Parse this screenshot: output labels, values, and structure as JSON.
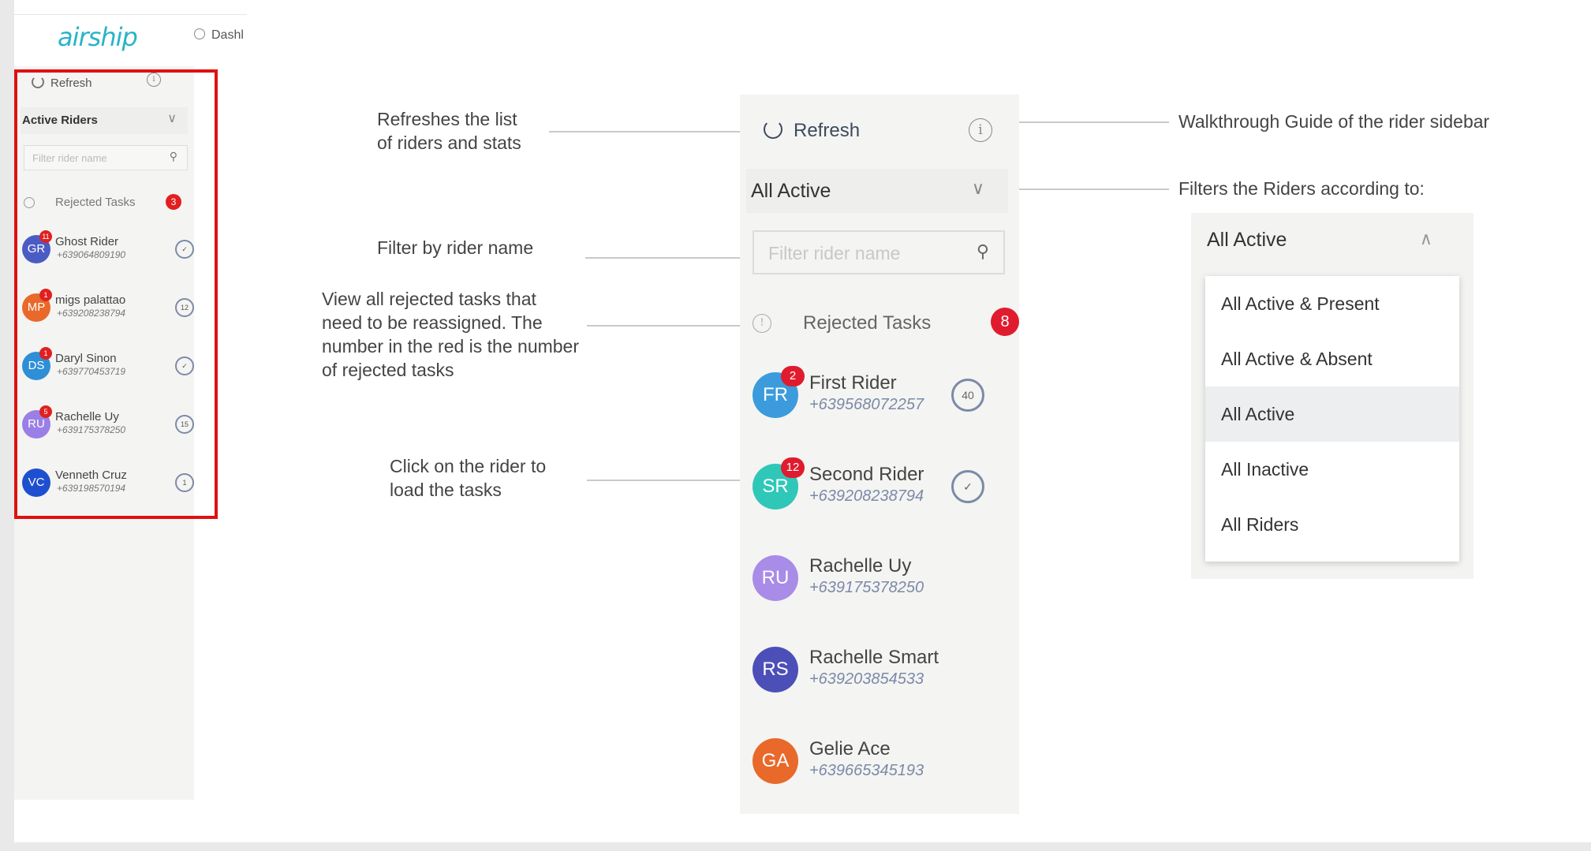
{
  "mini_app": {
    "logo": "airship",
    "dash_label": "Dashl",
    "refresh_label": "Refresh",
    "info_glyph": "i",
    "select_value": "Active Riders",
    "filter_placeholder": "Filter rider name",
    "rejected_label": "Rejected Tasks",
    "rejected_count": "3",
    "riders": [
      {
        "initials": "GR",
        "name": "Ghost Rider",
        "phone": "+639064809190",
        "badge": "11",
        "stat": "✓",
        "color": "#4a5cc4"
      },
      {
        "initials": "MP",
        "name": "migs palattao",
        "phone": "+639208238794",
        "badge": "1",
        "stat": "12",
        "color": "#e8692a"
      },
      {
        "initials": "DS",
        "name": "Daryl Sinon",
        "phone": "+639770453719",
        "badge": "1",
        "stat": "✓",
        "color": "#2e8fd6"
      },
      {
        "initials": "RU",
        "name": "Rachelle Uy",
        "phone": "+639175378250",
        "badge": "5",
        "stat": "15",
        "color": "#9a7fe6"
      },
      {
        "initials": "VC",
        "name": "Venneth Cruz",
        "phone": "+639198570194",
        "badge": "",
        "stat": "1",
        "color": "#1d4fd0"
      }
    ]
  },
  "big_sidebar": {
    "refresh_label": "Refresh",
    "info_glyph": "i",
    "select_value": "All Active",
    "select_chevron": "∨",
    "filter_placeholder": "Filter rider name",
    "search_glyph": "⚲",
    "rejected_label": "Rejected Tasks",
    "rejected_icon": "!",
    "rejected_count": "8",
    "riders": [
      {
        "initials": "FR",
        "name": "First Rider",
        "phone": "+639568072257",
        "badge": "2",
        "stat": "40",
        "color": "#3b9bdc"
      },
      {
        "initials": "SR",
        "name": "Second Rider",
        "phone": "+639208238794",
        "badge": "12",
        "stat": "✓",
        "color": "#2fc7b8"
      },
      {
        "initials": "RU",
        "name": "Rachelle Uy",
        "phone": "+639175378250",
        "badge": "",
        "stat": "",
        "color": "#a98be8"
      },
      {
        "initials": "RS",
        "name": "Rachelle Smart",
        "phone": "+639203854533",
        "badge": "",
        "stat": "",
        "color": "#4d4fb8"
      },
      {
        "initials": "GA",
        "name": "Gelie Ace",
        "phone": "+639665345193",
        "badge": "",
        "stat": "",
        "color": "#e8692a"
      }
    ]
  },
  "annotations": {
    "refresh": [
      "Refreshes the list",
      "of riders and stats"
    ],
    "filter_name": "Filter by rider name",
    "rejected": [
      "View all rejected tasks that",
      "need to be reassigned. The",
      "number in the red is the number",
      "of rejected tasks"
    ],
    "click_rider": [
      "Click on the rider to",
      "load the tasks"
    ],
    "walkthrough": "Walkthrough Guide of the rider sidebar",
    "filters": "Filters the Riders according to:"
  },
  "dropdown_demo": {
    "value": "All Active",
    "chevron": "∧",
    "options": [
      "All Active & Present",
      "All Active & Absent",
      "All Active",
      "All Inactive",
      "All Riders"
    ],
    "selected_index": 2
  }
}
